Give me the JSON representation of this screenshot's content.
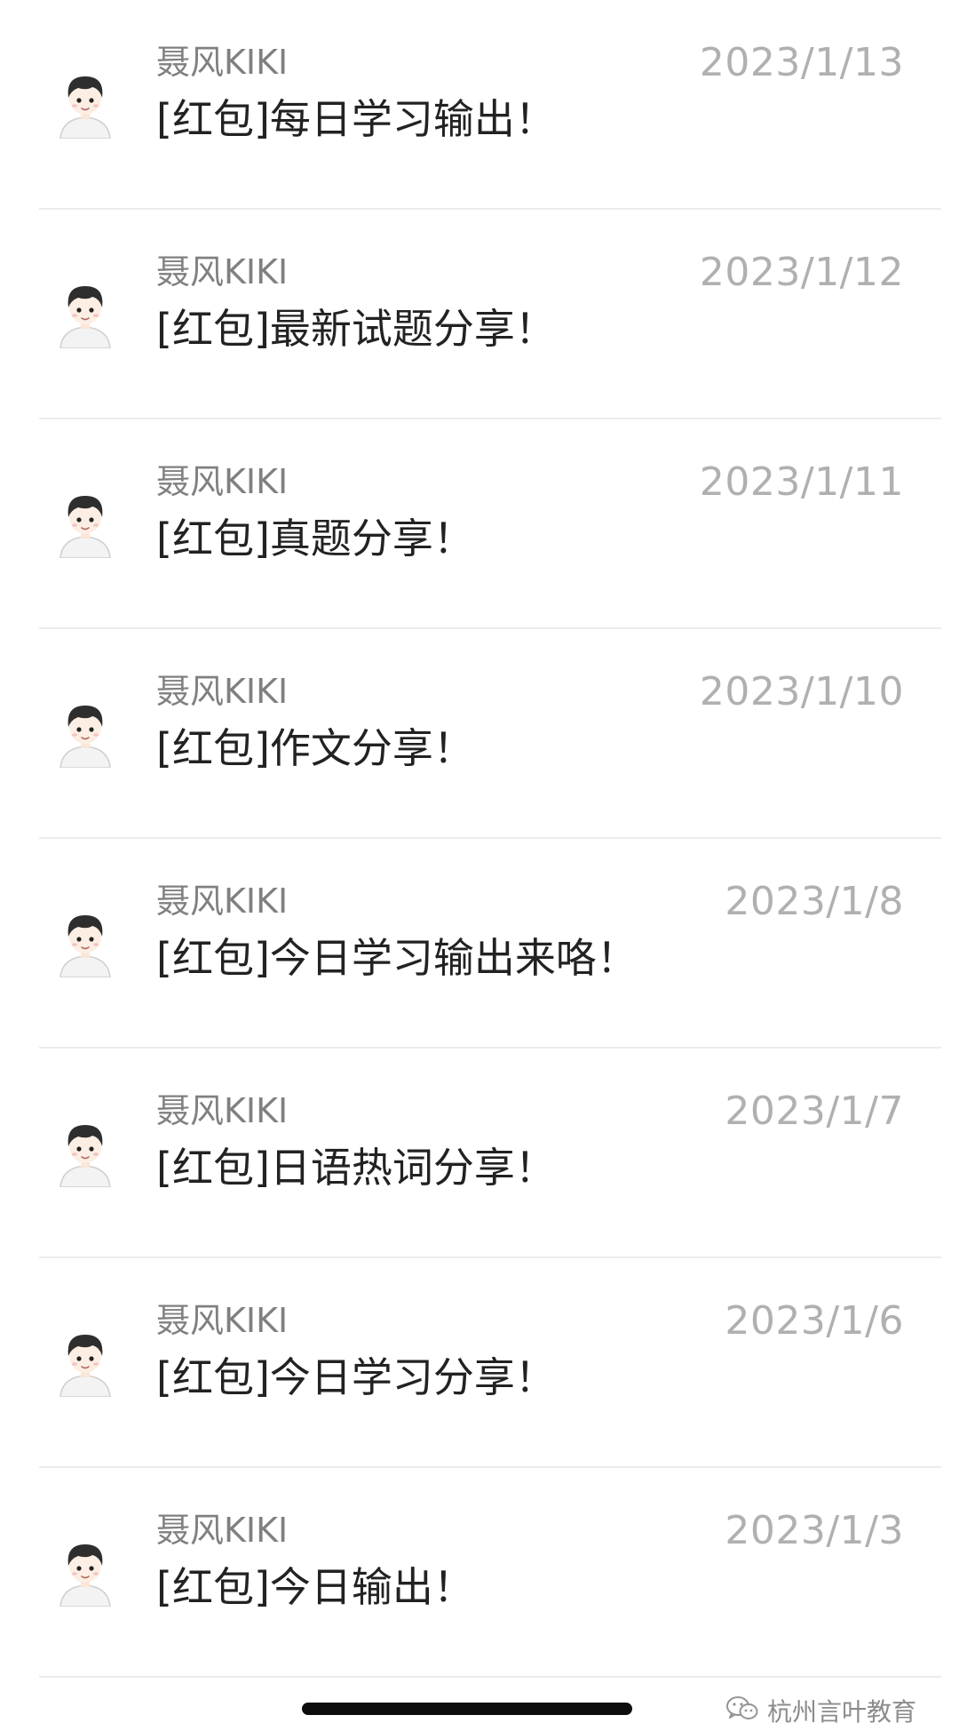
{
  "chats": [
    {
      "sender": "聂风KIKI",
      "date": "2023/1/13",
      "preview": "[红包]每日学习输出！"
    },
    {
      "sender": "聂风KIKI",
      "date": "2023/1/12",
      "preview": "[红包]最新试题分享！"
    },
    {
      "sender": "聂风KIKI",
      "date": "2023/1/11",
      "preview": "[红包]真题分享！"
    },
    {
      "sender": "聂风KIKI",
      "date": "2023/1/10",
      "preview": "[红包]作文分享！"
    },
    {
      "sender": "聂风KIKI",
      "date": "2023/1/8",
      "preview": "[红包]今日学习输出来咯！"
    },
    {
      "sender": "聂风KIKI",
      "date": "2023/1/7",
      "preview": "[红包]日语热词分享！"
    },
    {
      "sender": "聂风KIKI",
      "date": "2023/1/6",
      "preview": "[红包]今日学习分享！"
    },
    {
      "sender": "聂风KIKI",
      "date": "2023/1/3",
      "preview": "[红包]今日输出！"
    }
  ],
  "watermark": {
    "text": "杭州言叶教育",
    "icon": "wechat-icon"
  },
  "icons": {
    "avatar": "cartoon-boy-avatar"
  },
  "colors": {
    "sender": "#808080",
    "date": "#b0b0b0",
    "preview": "#222222",
    "divider": "#ececec"
  }
}
